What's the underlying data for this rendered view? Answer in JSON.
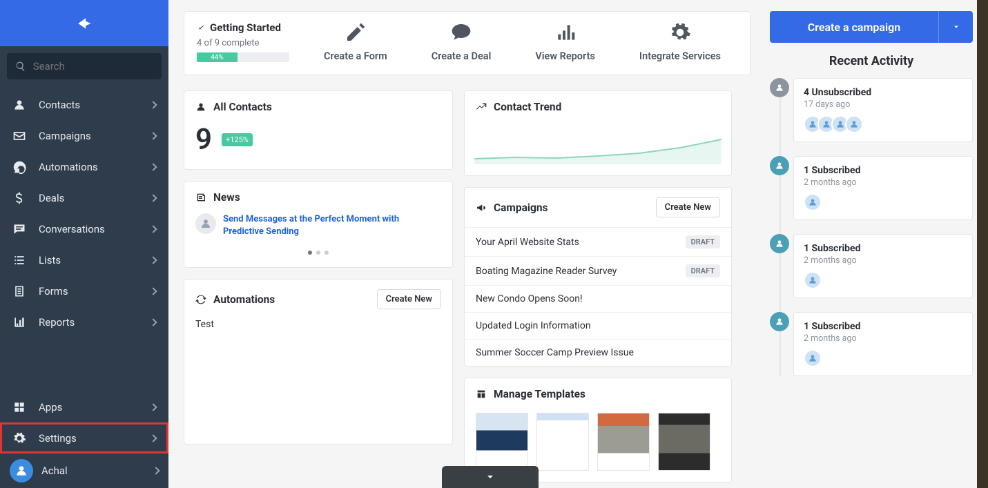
{
  "search": {
    "placeholder": "Search"
  },
  "sidebar": {
    "items": [
      {
        "label": "Contacts"
      },
      {
        "label": "Campaigns"
      },
      {
        "label": "Automations"
      },
      {
        "label": "Deals"
      },
      {
        "label": "Conversations"
      },
      {
        "label": "Lists"
      },
      {
        "label": "Forms"
      },
      {
        "label": "Reports"
      }
    ],
    "bottom": [
      {
        "label": "Apps"
      },
      {
        "label": "Settings"
      }
    ],
    "user": "Achal"
  },
  "getting_started": {
    "title": "Getting Started",
    "progress_text": "4 of 9 complete",
    "percent": "44%",
    "percent_num": 44,
    "actions": [
      {
        "label": "Create a Form"
      },
      {
        "label": "Create a Deal"
      },
      {
        "label": "View Reports"
      },
      {
        "label": "Integrate Services"
      }
    ]
  },
  "contacts_card": {
    "title": "All Contacts",
    "count": "9",
    "delta": "+125%"
  },
  "trend_card": {
    "title": "Contact Trend"
  },
  "news_card": {
    "title": "News",
    "headline": "Send Messages at the Perfect Moment with Predictive Sending"
  },
  "auto_card": {
    "title": "Automations",
    "create": "Create New",
    "item": "Test"
  },
  "campaigns_card": {
    "title": "Campaigns",
    "create": "Create New",
    "items": [
      {
        "name": "Your April Website Stats",
        "status": "DRAFT"
      },
      {
        "name": "Boating Magazine Reader Survey",
        "status": "DRAFT"
      },
      {
        "name": "New Condo Opens Soon!",
        "status": ""
      },
      {
        "name": "Updated Login Information",
        "status": ""
      },
      {
        "name": "Summer Soccer Camp Preview Issue",
        "status": ""
      }
    ]
  },
  "templates_card": {
    "title": "Manage Templates"
  },
  "cta": {
    "label": "Create a campaign"
  },
  "recent_activity": {
    "title": "Recent Activity",
    "items": [
      {
        "title": "4 Unsubscribed",
        "time": "17 days ago",
        "avatars": 4,
        "icon": "unsub"
      },
      {
        "title": "1 Subscribed",
        "time": "2 months ago",
        "avatars": 1,
        "icon": "sub"
      },
      {
        "title": "1 Subscribed",
        "time": "2 months ago",
        "avatars": 1,
        "icon": "sub"
      },
      {
        "title": "1 Subscribed",
        "time": "2 months ago",
        "avatars": 1,
        "icon": "sub"
      }
    ]
  }
}
